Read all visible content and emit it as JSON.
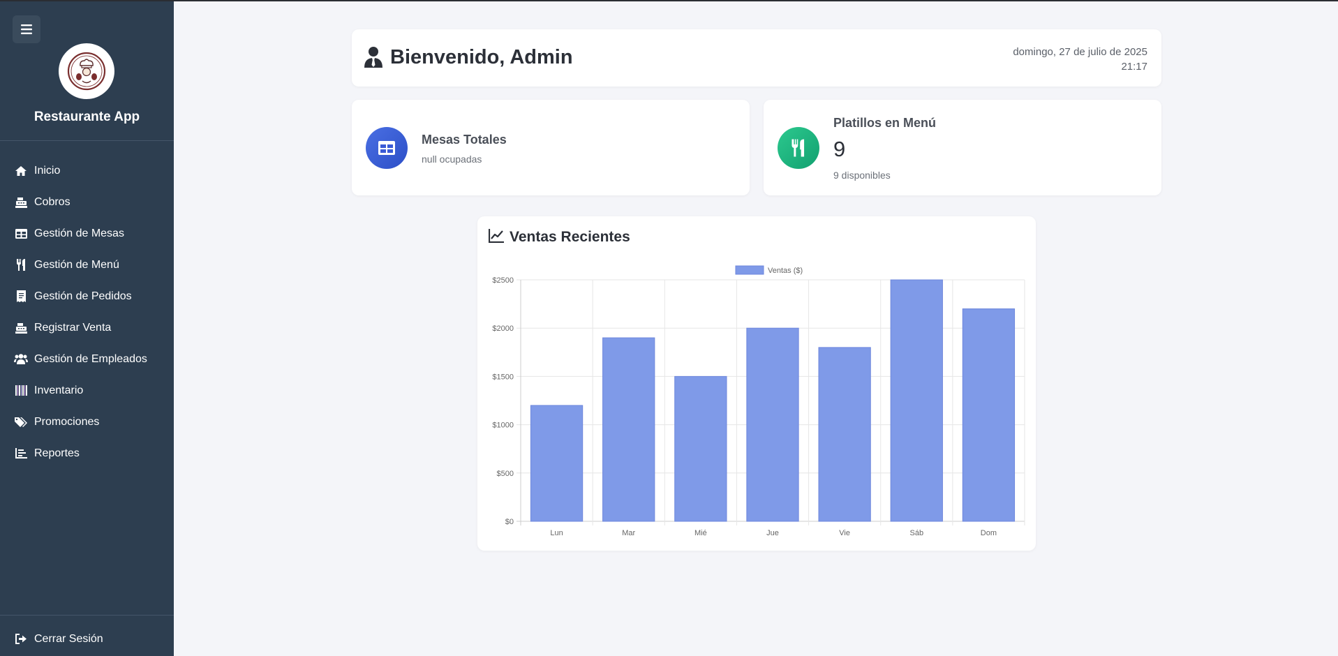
{
  "app": {
    "title": "Restaurante App",
    "accent": "#2d3e50"
  },
  "sidebar": {
    "items": [
      {
        "label": "Inicio",
        "icon": "home-icon"
      },
      {
        "label": "Cobros",
        "icon": "cash-register-icon"
      },
      {
        "label": "Gestión de Mesas",
        "icon": "table-icon"
      },
      {
        "label": "Gestión de Menú",
        "icon": "utensils-icon"
      },
      {
        "label": "Gestión de Pedidos",
        "icon": "receipt-icon"
      },
      {
        "label": "Registrar Venta",
        "icon": "cash-register-icon"
      },
      {
        "label": "Gestión de Empleados",
        "icon": "users-icon"
      },
      {
        "label": "Inventario",
        "icon": "barcode-icon"
      },
      {
        "label": "Promociones",
        "icon": "tags-icon"
      },
      {
        "label": "Reportes",
        "icon": "chart-bar-icon"
      }
    ],
    "logout_label": "Cerrar Sesión"
  },
  "header": {
    "welcome": "Bienvenido, Admin",
    "date": "domingo, 27 de julio de 2025",
    "time": "21:17"
  },
  "stats": {
    "mesas": {
      "title": "Mesas Totales",
      "sub": "null ocupadas",
      "color": "#3a5bd6"
    },
    "platillos": {
      "title": "Platillos en Menú",
      "value": "9",
      "sub": "9 disponibles",
      "color": "#19b47e"
    }
  },
  "chart": {
    "title": "Ventas Recientes"
  },
  "chart_data": {
    "type": "bar",
    "categories": [
      "Lun",
      "Mar",
      "Mié",
      "Jue",
      "Vie",
      "Sáb",
      "Dom"
    ],
    "series": [
      {
        "name": "Ventas ($)",
        "values": [
          1200,
          1900,
          1500,
          2000,
          1800,
          2500,
          2200
        ],
        "color": "#7f9ae8"
      }
    ],
    "yticks": [
      "$0",
      "$500",
      "$1000",
      "$1500",
      "$2000",
      "$2500"
    ],
    "ylim": [
      0,
      2500
    ],
    "legend": "top",
    "grid": true
  }
}
